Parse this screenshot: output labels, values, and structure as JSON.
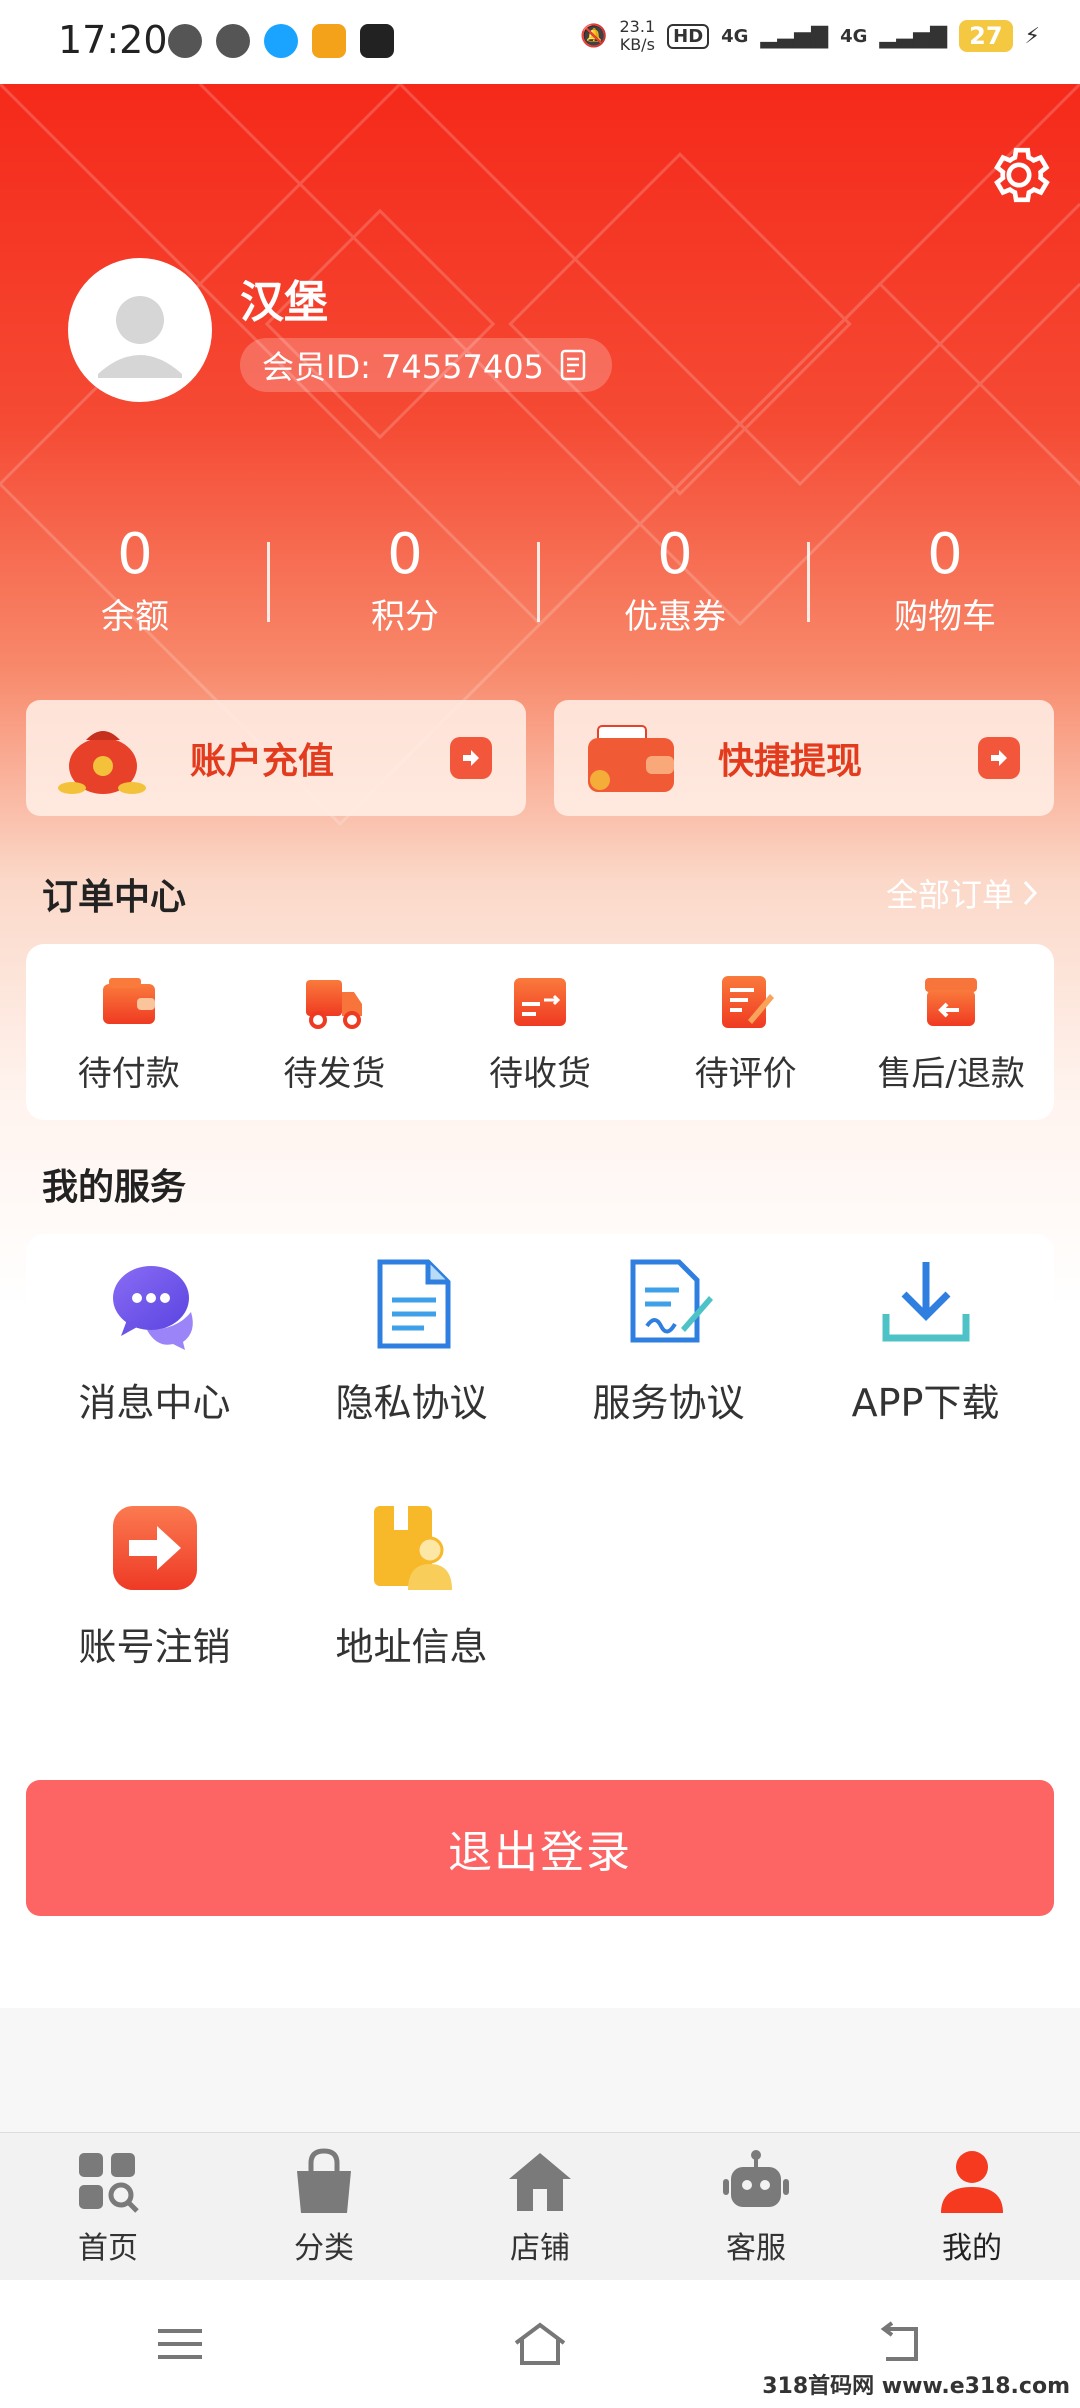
{
  "status_bar": {
    "time": "17:20",
    "net_speed_top": "23.1",
    "net_speed_unit": "KB/s",
    "battery": "27",
    "signal_1": "4G",
    "signal_2": "4G"
  },
  "profile": {
    "name": "汉堡",
    "member_id": "会员ID: 74557405"
  },
  "stats": [
    {
      "value": "0",
      "label": "余额"
    },
    {
      "value": "0",
      "label": "积分"
    },
    {
      "value": "0",
      "label": "优惠券"
    },
    {
      "value": "0",
      "label": "购物车"
    }
  ],
  "quick_actions": [
    {
      "label": "账户充值",
      "icon": "money-bag-icon"
    },
    {
      "label": "快捷提现",
      "icon": "wallet-icon"
    }
  ],
  "orders": {
    "title": "订单中心",
    "all_link": "全部订单",
    "items": [
      {
        "label": "待付款",
        "icon": "wallet-icon"
      },
      {
        "label": "待发货",
        "icon": "truck-icon"
      },
      {
        "label": "待收货",
        "icon": "package-icon"
      },
      {
        "label": "待评价",
        "icon": "review-icon"
      },
      {
        "label": "售后/退款",
        "icon": "refund-icon"
      }
    ]
  },
  "services": {
    "title": "我的服务",
    "items": [
      {
        "label": "消息中心",
        "icon": "chat-bubble-icon"
      },
      {
        "label": "隐私协议",
        "icon": "document-icon"
      },
      {
        "label": "服务协议",
        "icon": "signed-document-icon"
      },
      {
        "label": "APP下载",
        "icon": "download-icon"
      },
      {
        "label": "账号注销",
        "icon": "exit-arrow-icon"
      },
      {
        "label": "地址信息",
        "icon": "address-book-icon"
      }
    ]
  },
  "logout_label": "退出登录",
  "tabs": [
    {
      "label": "首页",
      "icon": "home-grid-icon",
      "active": false
    },
    {
      "label": "分类",
      "icon": "shopping-bag-icon",
      "active": false
    },
    {
      "label": "店铺",
      "icon": "store-icon",
      "active": false
    },
    {
      "label": "客服",
      "icon": "robot-icon",
      "active": false
    },
    {
      "label": "我的",
      "icon": "user-icon",
      "active": true
    }
  ],
  "watermark": "318首码网 www.e318.com",
  "colors": {
    "accent": "#f5291a",
    "logout": "#fd6464",
    "tab_active": "#f53a1f",
    "tab_inactive": "#7a7a7a"
  }
}
